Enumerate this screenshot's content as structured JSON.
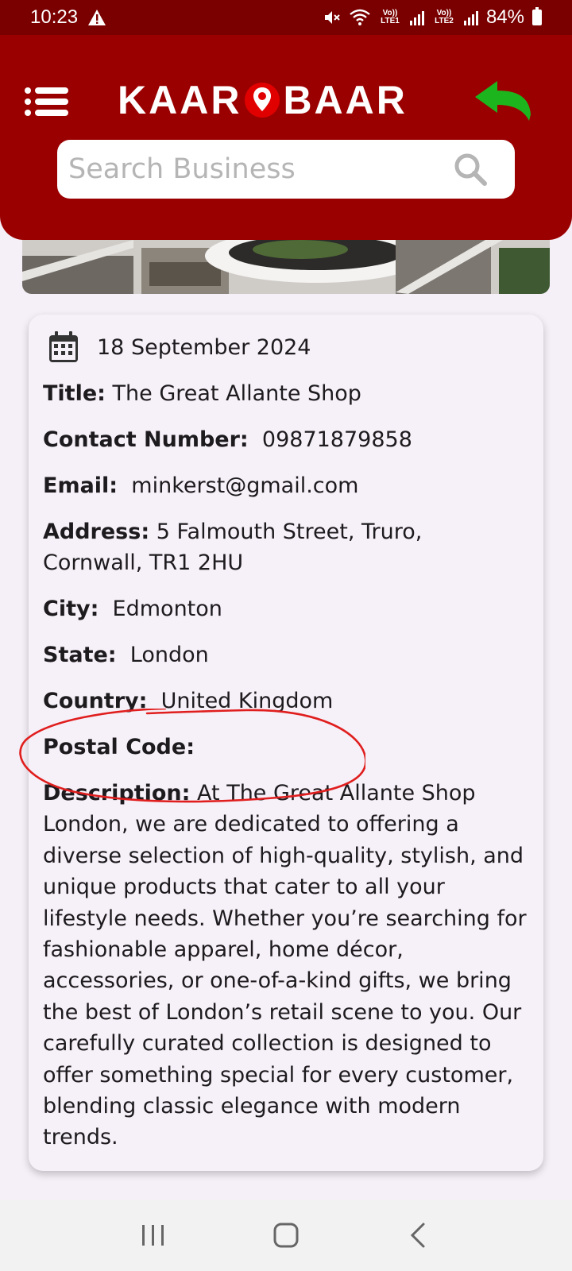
{
  "status_bar": {
    "time": "10:23",
    "battery": "84%",
    "sim1": "Vo)) LTE1",
    "sim2": "Vo)) LTE2"
  },
  "header": {
    "brand_left": "KAAR",
    "brand_right": "BAAR",
    "search_placeholder": "Search Business",
    "colors": {
      "header_bg": "#9b0000",
      "status_bg": "#7a0000",
      "back_arrow": "#1db51d"
    }
  },
  "listing": {
    "date": "18 September 2024",
    "fields": [
      {
        "label": "Title:",
        "value": "The Great Allante Shop"
      },
      {
        "label": "Contact Number:",
        "value": "09871879858"
      },
      {
        "label": "Email:",
        "value": "minkerst@gmail.com"
      },
      {
        "label": "Address:",
        "value": "5 Falmouth Street, Truro, Cornwall, TR1 2HU"
      },
      {
        "label": "City:",
        "value": "Edmonton"
      },
      {
        "label": "State:",
        "value": "London"
      },
      {
        "label": "Country:",
        "value": "United Kingdom"
      },
      {
        "label": "Postal Code:",
        "value": ""
      }
    ],
    "description_label": "Description:",
    "description": "At The Great Allante Shop London, we are dedicated to offering a diverse selection of high-quality, stylish, and unique products that cater to all your lifestyle needs. Whether you’re searching for fashionable apparel, home décor, accessories, or one-of-a-kind gifts, we bring the best of London’s retail scene to you. Our carefully curated collection is designed to offer something special for every customer, blending classic elegance with modern trends."
  },
  "icons": [
    "warning-icon",
    "mute-icon",
    "wifi-icon",
    "battery-icon",
    "menu-icon",
    "location-pin-icon",
    "back-arrow-icon",
    "search-icon",
    "calendar-icon",
    "recents-icon",
    "home-icon",
    "back-icon"
  ]
}
